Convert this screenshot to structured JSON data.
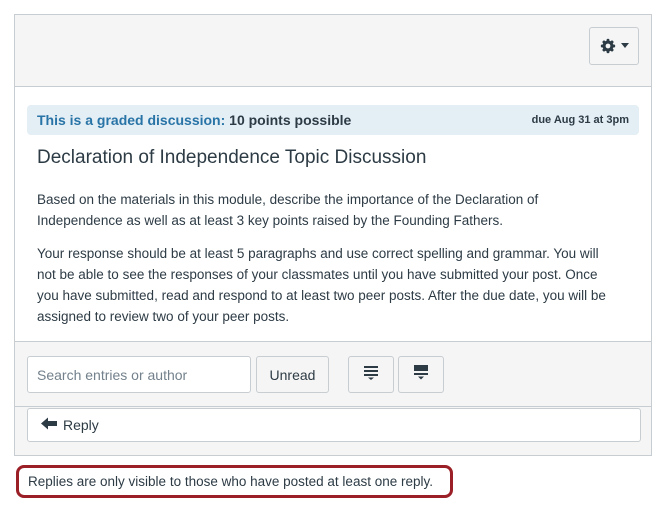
{
  "toolbar_top": {
    "settings_icon": "gear-icon",
    "dropdown_icon": "caret-down-icon"
  },
  "banner": {
    "graded_prefix": "This is a graded discussion:",
    "points": "10 points possible",
    "due": "due Aug 31 at 3pm"
  },
  "topic": {
    "title": "Declaration of Independence Topic Discussion",
    "paragraphs": [
      "Based on the materials in this module, describe the importance of the Declaration of Independence as well as at least 3 key points raised by the Founding Fathers.",
      "Your response should be at least 5 paragraphs and use correct spelling and grammar. You will not be able to see the responses of your classmates until you have submitted your post. Once you have submitted, read and respond to at least two peer posts. After the due date, you will be assigned to review two of your peer posts."
    ]
  },
  "filters": {
    "search_placeholder": "Search entries or author",
    "search_value": "",
    "unread_label": "Unread",
    "expand_icon": "expand-all-icon",
    "collapse_icon": "collapse-all-icon"
  },
  "reply": {
    "label": "Reply",
    "icon": "reply-arrow-icon"
  },
  "notice": {
    "text": "Replies are only visible to those who have posted at least one reply.",
    "border_color": "#9b1f26"
  },
  "colors": {
    "accent_blue": "#2874a6",
    "banner_bg": "#e4eef5",
    "border": "#c7cdd1"
  }
}
